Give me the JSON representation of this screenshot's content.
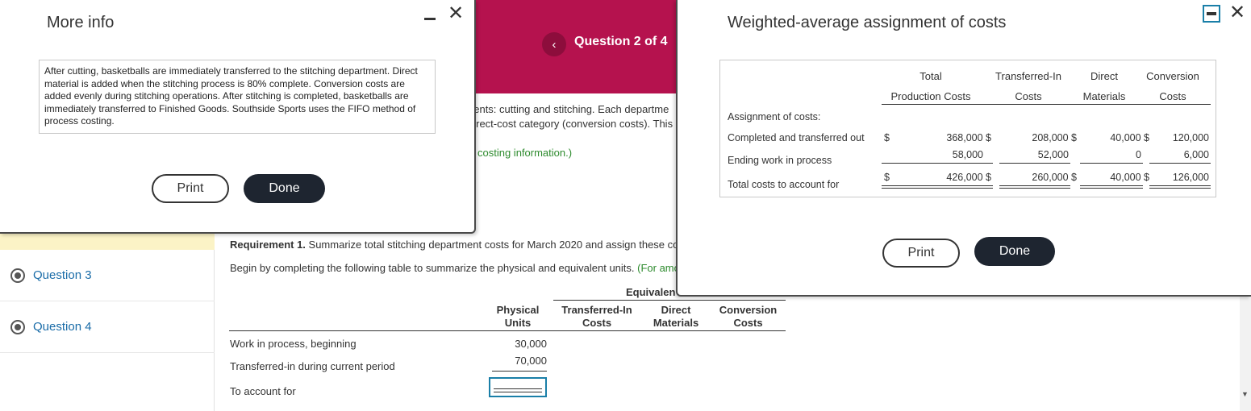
{
  "nav": {
    "items": [
      {
        "label": "Question 3"
      },
      {
        "label": "Question 4"
      }
    ]
  },
  "header": {
    "prev_icon": "‹",
    "question_counter": "Question 2 of 4"
  },
  "background_text": {
    "line1": "nents: cutting and stitching. Each departme",
    "line2": "direct-cost category (conversion costs). This",
    "line3": "costing information.)",
    "req_bold": "Requirement 1.",
    "req_text": " Summarize total stitching department costs for March 2020 and assign these co",
    "begin_text": "Begin by completing the following table to summarize the physical and equivalent units. ",
    "begin_green": "(For amo"
  },
  "units_table": {
    "group_header": "Equivalen",
    "col_physical": "Physical Units",
    "col_transferred": "Transferred-In Costs",
    "col_direct": "Direct Materials",
    "col_conversion": "Conversion Costs",
    "rows": [
      {
        "label": "Work in process, beginning",
        "physical": "30,000"
      },
      {
        "label": "Transferred-in during current period",
        "physical": "70,000"
      },
      {
        "label": "To account for",
        "physical": ""
      }
    ]
  },
  "more_info": {
    "title": "More info",
    "minimize_icon": "minimize-icon",
    "close_icon": "✕",
    "text": "After cutting, basketballs are immediately transferred to the stitching department. Direct material is added when the stitching process is 80% complete. Conversion costs are added evenly during stitching operations. After stitching is completed, basketballs are immediately transferred to Finished Goods. Southside Sports uses the FIFO method of process costing.",
    "print_label": "Print",
    "done_label": "Done"
  },
  "weighted_average": {
    "title": "Weighted-average assignment of costs",
    "close_icon": "✕",
    "headers": {
      "total": [
        "Total",
        "Production Costs"
      ],
      "transferred": [
        "Transferred-In",
        "Costs"
      ],
      "direct": [
        "Direct",
        "Materials"
      ],
      "conversion": [
        "Conversion",
        "Costs"
      ]
    },
    "section_label": "Assignment of costs:",
    "rows": [
      {
        "label": "Completed and transferred out",
        "dollar": "$",
        "total": "368,000 $",
        "transferred": "208,000 $",
        "direct": "40,000 $",
        "conversion": "120,000"
      },
      {
        "label": "Ending work in process",
        "dollar": "",
        "total": "58,000",
        "transferred": "52,000",
        "direct": "0",
        "conversion": "6,000"
      },
      {
        "label": "Total costs to account for",
        "dollar": "$",
        "total": "426,000 $",
        "transferred": "260,000 $",
        "direct": "40,000 $",
        "conversion": "126,000"
      }
    ],
    "print_label": "Print",
    "done_label": "Done"
  },
  "colors": {
    "header_bg": "#b5124e",
    "link_blue": "#1a6ca8",
    "accent_teal": "#1a7fa8",
    "highlight_yellow": "#fbf3c6",
    "green_text": "#2e8b2e"
  }
}
